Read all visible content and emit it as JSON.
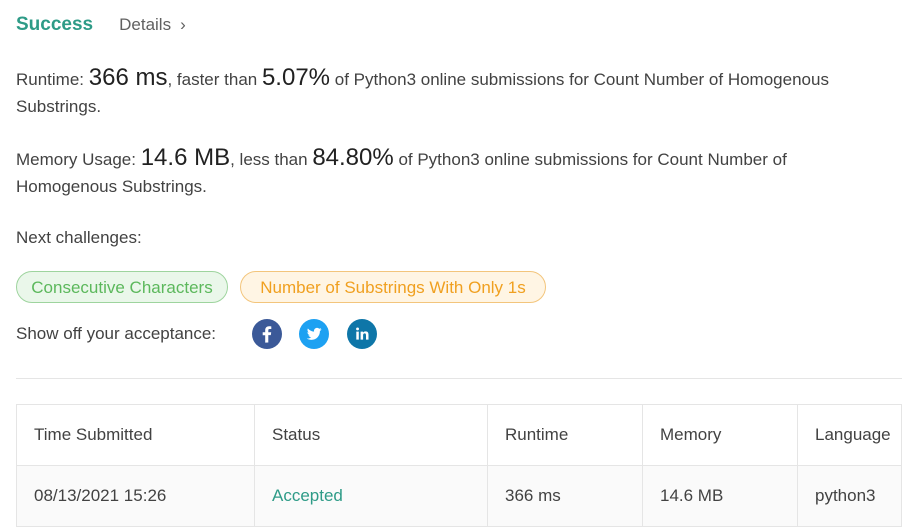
{
  "result": {
    "status": "Success",
    "details_label": "Details",
    "details_chevron": "›"
  },
  "runtime": {
    "label": "Runtime: ",
    "value": "366 ms",
    "middle": ", faster than ",
    "percent": "5.07%",
    "suffix": " of Python3 online submissions for Count Number of Homogenous Substrings."
  },
  "memory": {
    "label": "Memory Usage: ",
    "value": "14.6 MB",
    "middle": ", less than ",
    "percent": "84.80%",
    "suffix": " of Python3 online submissions for Count Number of Homogenous Substrings."
  },
  "next_challenges": {
    "label": "Next challenges:",
    "items": [
      {
        "label": "Consecutive Characters",
        "difficulty": "easy",
        "color": "#5cb85c"
      },
      {
        "label": "Number of Substrings With Only 1s",
        "difficulty": "medium",
        "color": "#f0a020"
      }
    ]
  },
  "share": {
    "label": "Show off your acceptance:",
    "icons": [
      "facebook-icon",
      "twitter-icon",
      "linkedin-icon"
    ]
  },
  "submissions": {
    "columns": [
      "Time Submitted",
      "Status",
      "Runtime",
      "Memory",
      "Language"
    ],
    "rows": [
      {
        "time": "08/13/2021 15:26",
        "status": "Accepted",
        "runtime": "366 ms",
        "memory": "14.6 MB",
        "language": "python3"
      }
    ]
  },
  "colors": {
    "success": "#2e9b87",
    "facebook": "#3b5998",
    "twitter": "#1da1f2",
    "linkedin": "#0e76a8"
  }
}
